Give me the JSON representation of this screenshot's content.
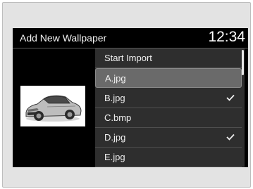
{
  "header": {
    "title": "Add New Wallpaper",
    "clock": "12:34"
  },
  "preview": {
    "icon": "car-image"
  },
  "list": {
    "items": [
      {
        "label": "Start Import",
        "checked": false,
        "selected": false
      },
      {
        "label": "A.jpg",
        "checked": false,
        "selected": true
      },
      {
        "label": "B.jpg",
        "checked": true,
        "selected": false
      },
      {
        "label": "C.bmp",
        "checked": false,
        "selected": false
      },
      {
        "label": "D.jpg",
        "checked": true,
        "selected": false
      },
      {
        "label": "E.jpg",
        "checked": false,
        "selected": false
      }
    ]
  }
}
